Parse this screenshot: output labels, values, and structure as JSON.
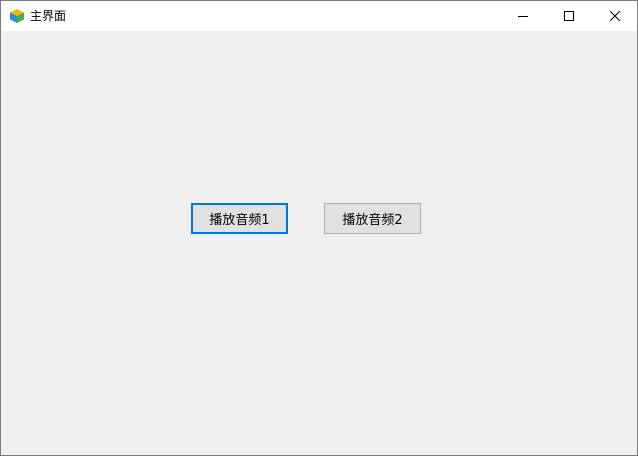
{
  "window": {
    "title": "主界面",
    "icon": "app-cube-icon",
    "controls": {
      "minimize_icon": "minimize-icon",
      "maximize_icon": "maximize-icon",
      "close_icon": "close-icon"
    }
  },
  "main": {
    "buttons": [
      {
        "label": "播放音频1",
        "focused": true
      },
      {
        "label": "播放音频2",
        "focused": false
      }
    ]
  },
  "colors": {
    "client_background": "#efefef",
    "titlebar_background": "#ffffff",
    "button_background": "#e1e1e1",
    "focus_border": "#0078d7"
  }
}
